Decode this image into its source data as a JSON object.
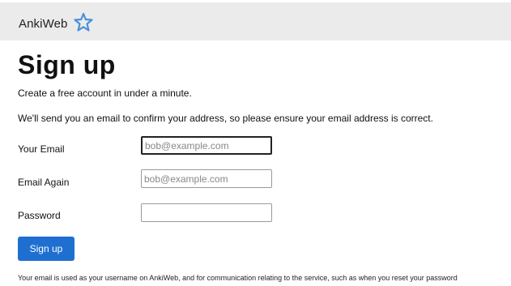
{
  "header": {
    "brand": "AnkiWeb",
    "logo_icon": "star-outline-icon",
    "accent": "#4a90d9"
  },
  "page": {
    "title": "Sign up",
    "intro": "Create a free account in under a minute.",
    "confirm_text": "We'll send you an email to confirm your address, so please ensure your email address is correct."
  },
  "form": {
    "email": {
      "label": "Your Email",
      "placeholder": "bob@example.com",
      "value": ""
    },
    "email_again": {
      "label": "Email Again",
      "placeholder": "bob@example.com",
      "value": ""
    },
    "password": {
      "label": "Password",
      "placeholder": "",
      "value": ""
    },
    "submit_label": "Sign up",
    "submit_color": "#1f6fd1"
  },
  "footer_note": "Your email is used as your username on AnkiWeb, and for communication relating to the service, such as when you reset your password"
}
